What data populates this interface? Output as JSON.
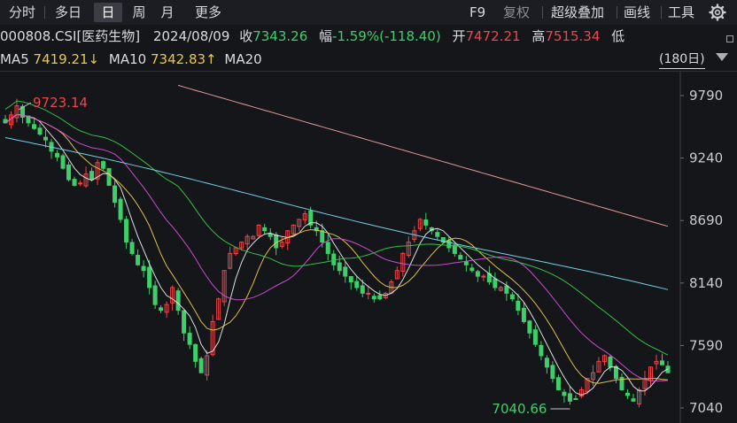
{
  "toolbar": {
    "tabs": [
      {
        "label": "分时"
      },
      {
        "label": "多日"
      },
      {
        "label": "日",
        "active": true
      },
      {
        "label": "周"
      },
      {
        "label": "月"
      },
      {
        "label": "更多"
      }
    ],
    "right": {
      "f9": "F9",
      "fuquan": "复权",
      "overlay": "超级叠加",
      "draw": "画线",
      "tools": "工具"
    }
  },
  "quote": {
    "code": "000808.CSI[医药生物]",
    "date": "2024/08/09",
    "close_label": "收",
    "close": "7343.26",
    "change_label": "幅",
    "change": "-1.59%(-118.40)",
    "open_label": "开",
    "open": "7472.21",
    "high_label": "高",
    "high": "7515.34",
    "low_label": "低"
  },
  "ma": {
    "ma5_label": "MA5",
    "ma5": "7419.21↓",
    "ma10_label": "MA10",
    "ma10": "7342.83↑",
    "ma20_label": "MA20",
    "period": "(180日)"
  },
  "colors": {
    "up": "#f0454a",
    "down": "#3fcf6a",
    "ma5": "#e8e8e8",
    "ma10": "#e8c84a",
    "ma20": "#d44fd8",
    "ma60": "#37c84a",
    "ma120": "#7ad8ee",
    "ma250": "#f0a0a0"
  },
  "chart_data": {
    "type": "candlestick",
    "y_ticks": [
      9790,
      9240,
      8690,
      8140,
      7590,
      7040
    ],
    "ylim": [
      6960,
      10000
    ],
    "annotations": [
      {
        "label": "9723.14",
        "type": "high"
      },
      {
        "label": "7040.66",
        "type": "low"
      }
    ],
    "close_path": [
      9550,
      9620,
      9700,
      9600,
      9550,
      9500,
      9450,
      9400,
      9300,
      9250,
      9150,
      9050,
      9000,
      9020,
      9100,
      9050,
      9200,
      9150,
      9000,
      8850,
      8700,
      8500,
      8400,
      8300,
      8250,
      8100,
      7950,
      7900,
      7950,
      8100,
      7900,
      7700,
      7600,
      7450,
      7350,
      7500,
      7800,
      8000,
      8250,
      8400,
      8450,
      8500,
      8550,
      8550,
      8650,
      8600,
      8550,
      8450,
      8500,
      8600,
      8650,
      8700,
      8750,
      8650,
      8600,
      8500,
      8400,
      8300,
      8250,
      8200,
      8150,
      8100,
      8050,
      8050,
      8000,
      8000,
      8050,
      8150,
      8250,
      8400,
      8500,
      8600,
      8700,
      8650,
      8600,
      8550,
      8500,
      8450,
      8400,
      8350,
      8300,
      8250,
      8200,
      8200,
      8150,
      8100,
      8100,
      8050,
      8000,
      7900,
      7800,
      7700,
      7600,
      7500,
      7400,
      7300,
      7200,
      7150,
      7100,
      7120,
      7200,
      7300,
      7350,
      7450,
      7500,
      7400,
      7300,
      7200,
      7150,
      7100,
      7200,
      7300,
      7400,
      7450,
      7420,
      7350
    ],
    "ma_series": [
      {
        "name": "MA5",
        "period": 5
      },
      {
        "name": "MA10",
        "period": 10
      },
      {
        "name": "MA20",
        "period": 20
      },
      {
        "period": 60
      },
      {
        "period": 120
      },
      {
        "period": 250
      }
    ]
  }
}
